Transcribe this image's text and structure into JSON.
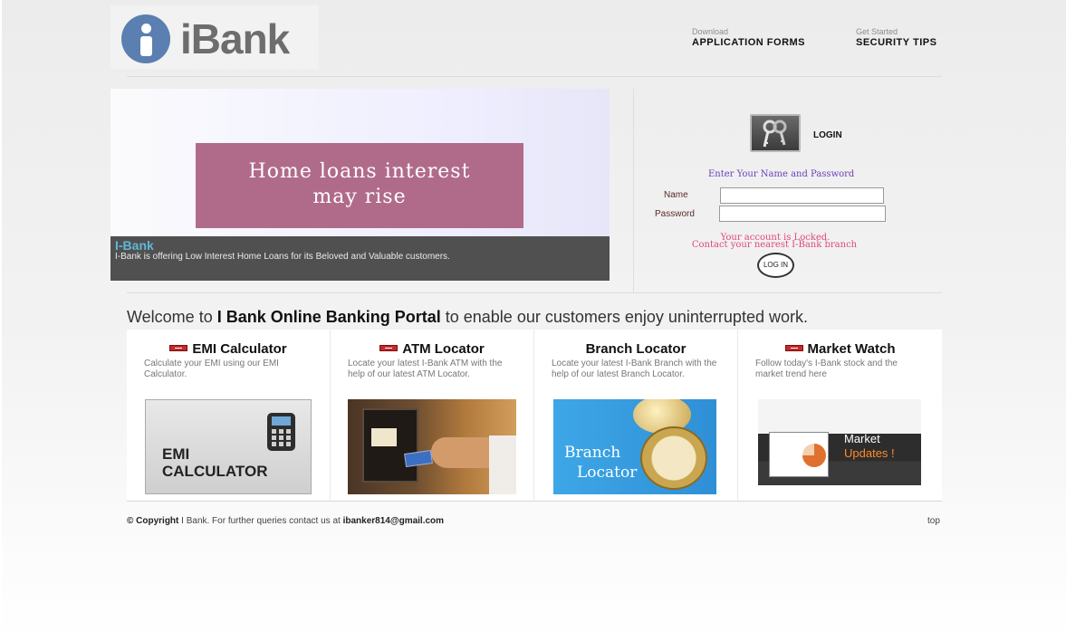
{
  "header": {
    "logo_text": "iBank",
    "links": [
      {
        "small": "Download",
        "label": "APPLICATION FORMS"
      },
      {
        "small": "Get Started",
        "label": "SECURITY TIPS"
      }
    ]
  },
  "banner": {
    "sign_line1": "Home loans interest",
    "sign_line2": "may rise",
    "caption_title": "I-Bank",
    "caption_text": "I-Bank is offering Low Interest Home Loans for its Beloved and Valuable customers."
  },
  "login": {
    "title": "LOGIN",
    "prompt": "Enter Your Name and Password",
    "name_label": "Name",
    "password_label": "Password",
    "name_value": "",
    "password_value": "",
    "error_line1": "Your account is Locked.",
    "error_line2": "Contact your nearest I-Bank branch",
    "button_label": "LOG IN"
  },
  "welcome": {
    "prefix": "Welcome to ",
    "portal": "I Bank Online Banking Portal",
    "suffix": " to enable our customers enjoy uninterrupted work."
  },
  "features": [
    {
      "title": "EMI Calculator",
      "desc": "Calculate your EMI using our EMI Calculator.",
      "img_label": "EMI CALCULATOR",
      "new": true
    },
    {
      "title": "ATM Locator",
      "desc": "Locate your latest I-Bank ATM with the help of our latest ATM Locator.",
      "new": true
    },
    {
      "title": "Branch Locator",
      "desc": "Locate your latest I-Bank Branch with the help of our latest Branch Locator.",
      "img_line1": "Branch",
      "img_line2": "Locator",
      "new": false
    },
    {
      "title": "Market Watch",
      "desc": "Follow today's I-Bank stock and the market trend here",
      "img_line1": "Market",
      "img_line2": "Updates !",
      "new": true
    }
  ],
  "emi_img": {
    "line1": "EMI",
    "line2": "CALCULATOR"
  },
  "footer": {
    "copyright": "© Copyright",
    "text": " I Bank. For further queries contact us at ",
    "email": "ibanker814@gmail.com",
    "top": "top"
  },
  "colors": {
    "logo_blue": "#5a7fb0",
    "error_pink": "#e0487a",
    "prompt_purple": "#6a3fb8",
    "caption_blue": "#5fb7d6"
  }
}
